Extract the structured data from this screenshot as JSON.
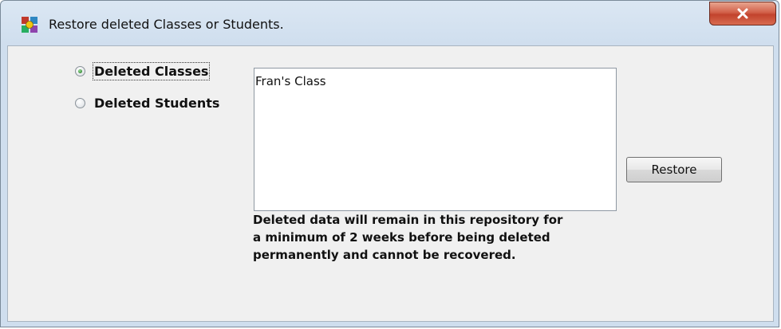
{
  "window": {
    "title": "Restore deleted Classes or Students.",
    "close_icon": "close-icon"
  },
  "options": {
    "deleted_classes_label": "Deleted Classes",
    "deleted_students_label": "Deleted Students",
    "selected": "Deleted Classes"
  },
  "list": {
    "items": [
      "Fran's Class"
    ]
  },
  "actions": {
    "restore_label": "Restore"
  },
  "note": {
    "lines": [
      "Deleted data will remain in this repository for",
      "a minimum of 2 weeks before being deleted",
      "permanently and cannot be recovered."
    ]
  },
  "colors": {
    "close_button": "#c2432d",
    "title_bar": "#dbe7f3",
    "client_background": "#f0f0f0",
    "radio_selected": "#2b7a2b"
  }
}
